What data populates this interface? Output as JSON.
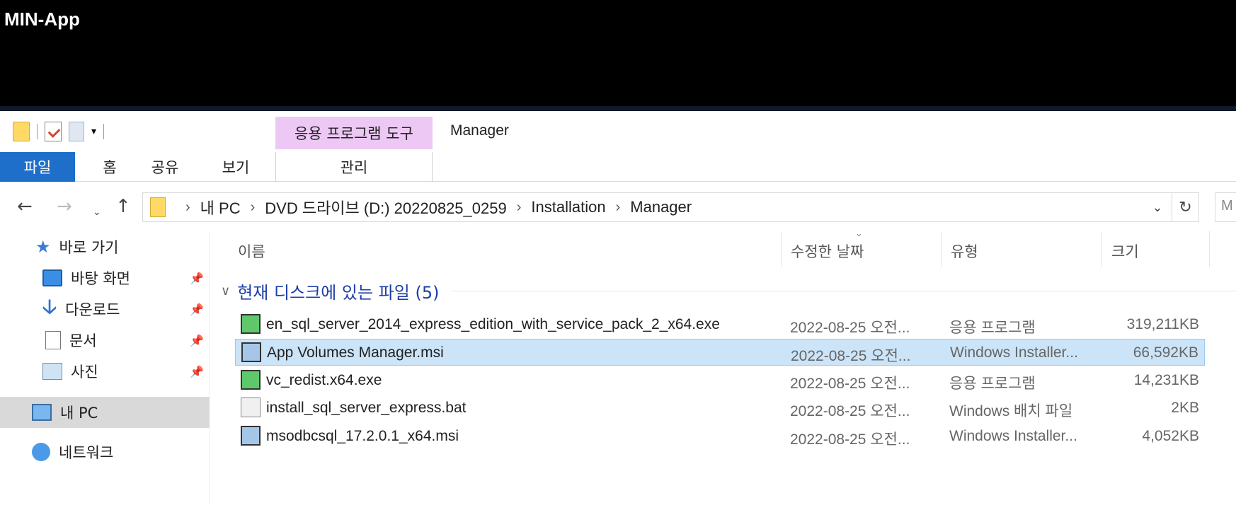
{
  "app": {
    "title": "MIN-App"
  },
  "ribbon": {
    "context_group": "응용 프로그램 도구",
    "window_name": "Manager",
    "tabs": {
      "file": "파일",
      "home": "홈",
      "share": "공유",
      "view": "보기",
      "manage": "관리"
    }
  },
  "address": {
    "crumbs": [
      "내 PC",
      "DVD 드라이브 (D:) 20220825_0259",
      "Installation",
      "Manager"
    ],
    "search_placeholder": "M"
  },
  "nav": {
    "quick_access": "바로 가기",
    "desktop": "바탕 화면",
    "downloads": "다운로드",
    "documents": "문서",
    "pictures": "사진",
    "this_pc": "내 PC",
    "network": "네트워크"
  },
  "columns": {
    "name": "이름",
    "modified": "수정한 날짜",
    "type": "유형",
    "size": "크기"
  },
  "group": {
    "label": "현재 디스크에 있는 파일 (5)"
  },
  "files": [
    {
      "name": "en_sql_server_2014_express_edition_with_service_pack_2_x64.exe",
      "modified": "2022-08-25 오전...",
      "type": "응용 프로그램",
      "size": "319,211KB",
      "icon": "exe-installer-icon"
    },
    {
      "name": "App Volumes Manager.msi",
      "modified": "2022-08-25 오전...",
      "type": "Windows Installer...",
      "size": "66,592KB",
      "icon": "msi-installer-icon",
      "selected": true
    },
    {
      "name": "vc_redist.x64.exe",
      "modified": "2022-08-25 오전...",
      "type": "응용 프로그램",
      "size": "14,231KB",
      "icon": "exe-installer-icon"
    },
    {
      "name": "install_sql_server_express.bat",
      "modified": "2022-08-25 오전...",
      "type": "Windows 배치 파일",
      "size": "2KB",
      "icon": "batch-file-icon"
    },
    {
      "name": "msodbcsql_17.2.0.1_x64.msi",
      "modified": "2022-08-25 오전...",
      "type": "Windows Installer...",
      "size": "4,052KB",
      "icon": "msi-installer-icon"
    }
  ]
}
